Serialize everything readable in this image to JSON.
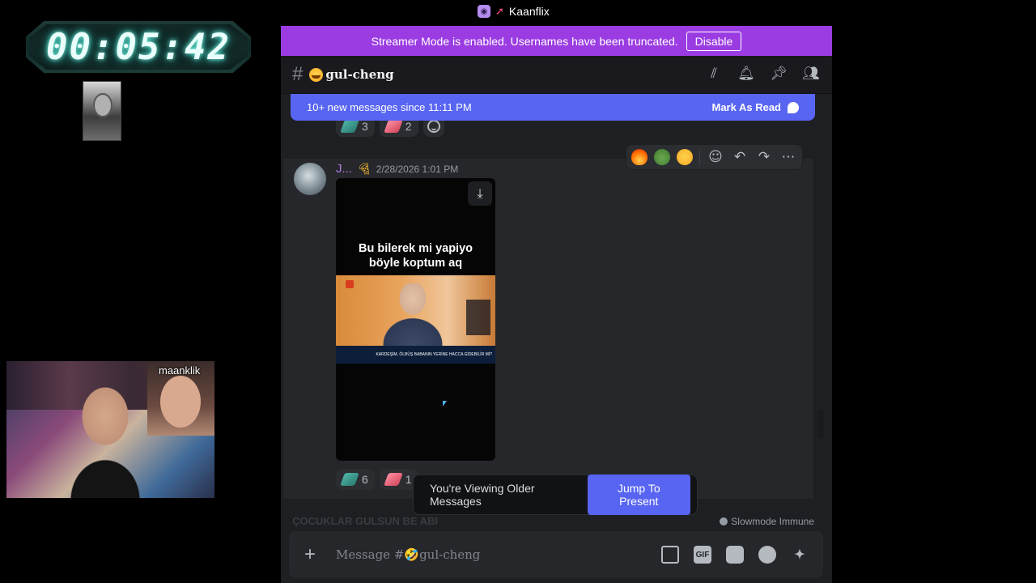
{
  "overlay": {
    "timer": "00:05:42",
    "webcam_name": "maanklik"
  },
  "window": {
    "title": "Kaanflix"
  },
  "streamer_bar": {
    "message": "Streamer Mode is enabled. Usernames have been truncated.",
    "disable_label": "Disable"
  },
  "channel": {
    "hash": "#",
    "name": "gul-cheng"
  },
  "new_messages": {
    "text": "10+ new messages since 11:11 PM",
    "mark_label": "Mark As Read"
  },
  "prev_reactions": [
    {
      "count": "3"
    },
    {
      "count": "2"
    }
  ],
  "message": {
    "username": "J...",
    "timestamp": "2/28/2026 1:01 PM",
    "caption_line1": "Bu bilerek mi yapiyo",
    "caption_line2": "böyle koptum aq",
    "lower_third": "KARDEŞİM, ÖLBÜŞ BABANIN YERİNE HACCA GİDEBİLİR Mİ?",
    "reactions": [
      {
        "count": "6"
      },
      {
        "count": "1"
      }
    ]
  },
  "older_bar": {
    "text": "You're Viewing Older Messages",
    "button": "Jump To Present"
  },
  "faded": {
    "text": "ÇOCUKLAR GULSUN BE ABI",
    "slowmode": "Slowmode Immune"
  },
  "composer": {
    "placeholder": "Message #🤣gul-cheng",
    "gif_label": "GIF"
  }
}
